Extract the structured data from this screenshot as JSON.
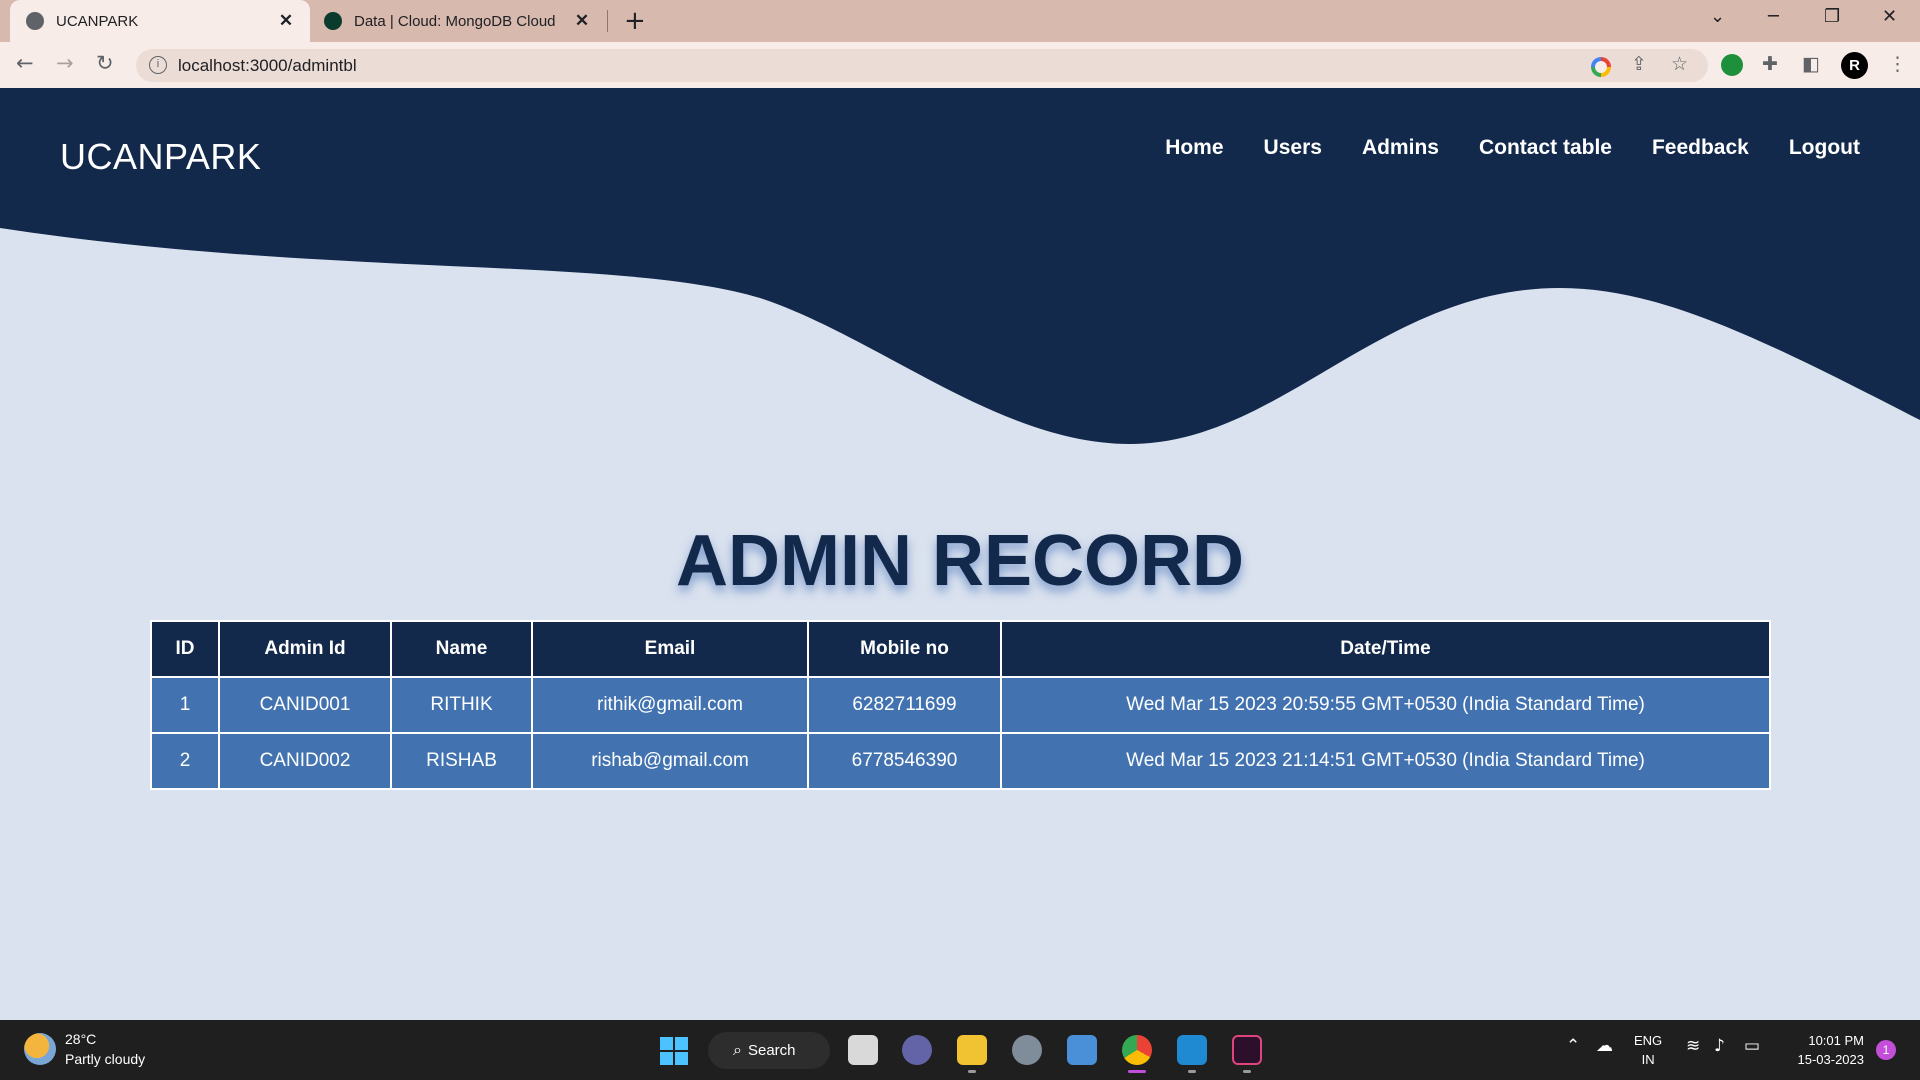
{
  "browser": {
    "tabs": [
      {
        "title": "UCANPARK",
        "icon": "globe-icon",
        "active": true
      },
      {
        "title": "Data | Cloud: MongoDB Cloud",
        "icon": "mongodb-leaf-icon",
        "active": false
      }
    ],
    "url": "localhost:3000/admintbl"
  },
  "site": {
    "brand": "UCANPARK",
    "nav": [
      "Home",
      "Users",
      "Admins",
      "Contact table",
      "Feedback",
      "Logout"
    ],
    "colors": {
      "header": "#13294b",
      "background": "#dae2ef",
      "row": "#4273b0"
    }
  },
  "main": {
    "heading": "ADMIN RECORD",
    "table": {
      "columns": [
        "ID",
        "Admin Id",
        "Name",
        "Email",
        "Mobile no",
        "Date/Time"
      ],
      "rows": [
        [
          "1",
          "CANID001",
          "RITHIK",
          "rithik@gmail.com",
          "6282711699",
          "Wed Mar 15 2023 20:59:55 GMT+0530 (India Standard Time)"
        ],
        [
          "2",
          "CANID002",
          "RISHAB",
          "rishab@gmail.com",
          "6778546390",
          "Wed Mar 15 2023 21:14:51 GMT+0530 (India Standard Time)"
        ]
      ]
    }
  },
  "taskbar": {
    "weather_temp": "28°C",
    "weather_desc": "Partly cloudy",
    "search_label": "Search",
    "lang_line1": "ENG",
    "lang_line2": "IN",
    "time": "10:01 PM",
    "date": "15-03-2023",
    "notification_count": "1"
  }
}
